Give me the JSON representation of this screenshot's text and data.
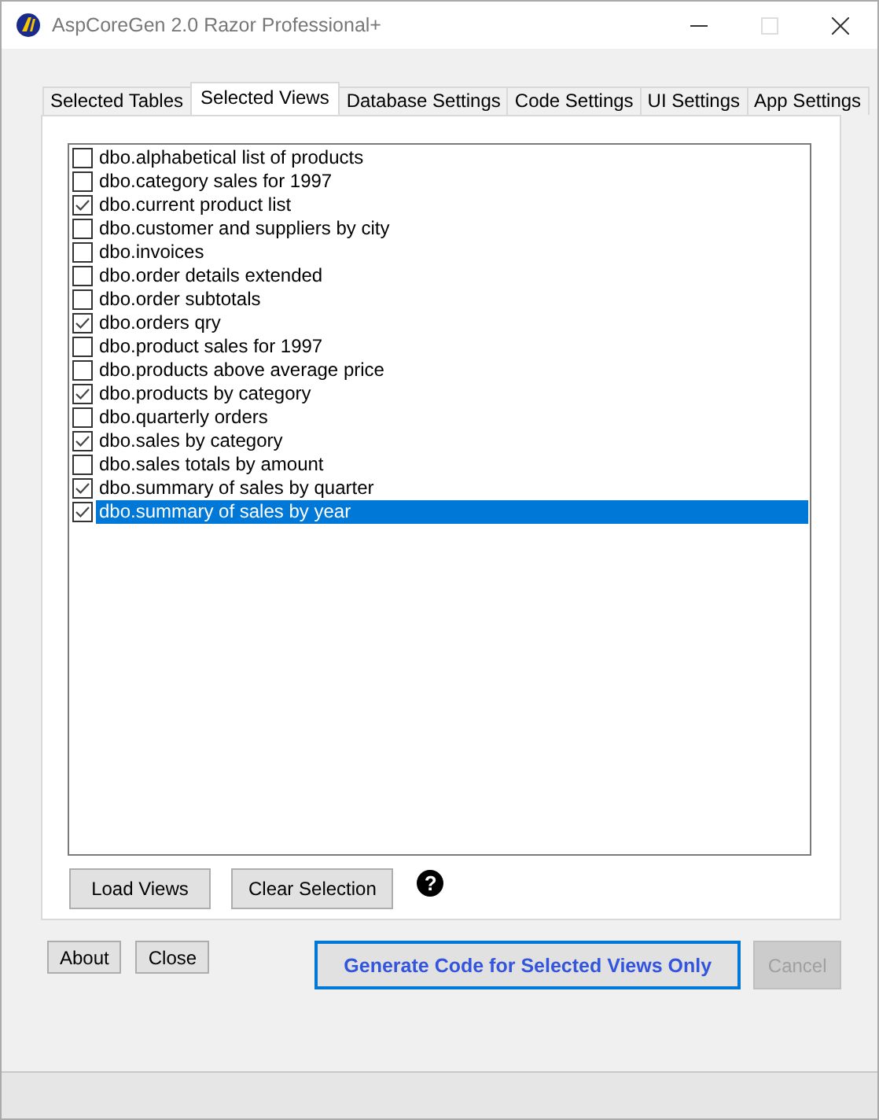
{
  "window": {
    "title": "AspCoreGen 2.0 Razor Professional+"
  },
  "tabs": [
    {
      "label": "Selected Tables",
      "selected": false
    },
    {
      "label": "Selected Views",
      "selected": true
    },
    {
      "label": "Database Settings",
      "selected": false
    },
    {
      "label": "Code Settings",
      "selected": false
    },
    {
      "label": "UI Settings",
      "selected": false
    },
    {
      "label": "App Settings",
      "selected": false
    }
  ],
  "views": [
    {
      "label": "dbo.alphabetical list of products",
      "checked": false,
      "selected": false
    },
    {
      "label": "dbo.category sales for 1997",
      "checked": false,
      "selected": false
    },
    {
      "label": "dbo.current product list",
      "checked": true,
      "selected": false
    },
    {
      "label": "dbo.customer and suppliers by city",
      "checked": false,
      "selected": false
    },
    {
      "label": "dbo.invoices",
      "checked": false,
      "selected": false
    },
    {
      "label": "dbo.order details extended",
      "checked": false,
      "selected": false
    },
    {
      "label": "dbo.order subtotals",
      "checked": false,
      "selected": false
    },
    {
      "label": "dbo.orders qry",
      "checked": true,
      "selected": false
    },
    {
      "label": "dbo.product sales for 1997",
      "checked": false,
      "selected": false
    },
    {
      "label": "dbo.products above average price",
      "checked": false,
      "selected": false
    },
    {
      "label": "dbo.products by category",
      "checked": true,
      "selected": false
    },
    {
      "label": "dbo.quarterly orders",
      "checked": false,
      "selected": false
    },
    {
      "label": "dbo.sales by category",
      "checked": true,
      "selected": false
    },
    {
      "label": "dbo.sales totals by amount",
      "checked": false,
      "selected": false
    },
    {
      "label": "dbo.summary of sales by quarter",
      "checked": true,
      "selected": false
    },
    {
      "label": "dbo.summary of sales by year",
      "checked": true,
      "selected": true
    }
  ],
  "panel_buttons": [
    "Load Views",
    "Clear Selection"
  ],
  "help_icon": "?",
  "footer_buttons": [
    {
      "label": "About",
      "kind": "small",
      "disabled": false
    },
    {
      "label": "Close",
      "kind": "small",
      "disabled": false
    },
    {
      "label": "Generate Code for Selected Views Only",
      "kind": "primary",
      "disabled": false
    },
    {
      "label": "Cancel",
      "kind": "normal",
      "disabled": true
    }
  ]
}
